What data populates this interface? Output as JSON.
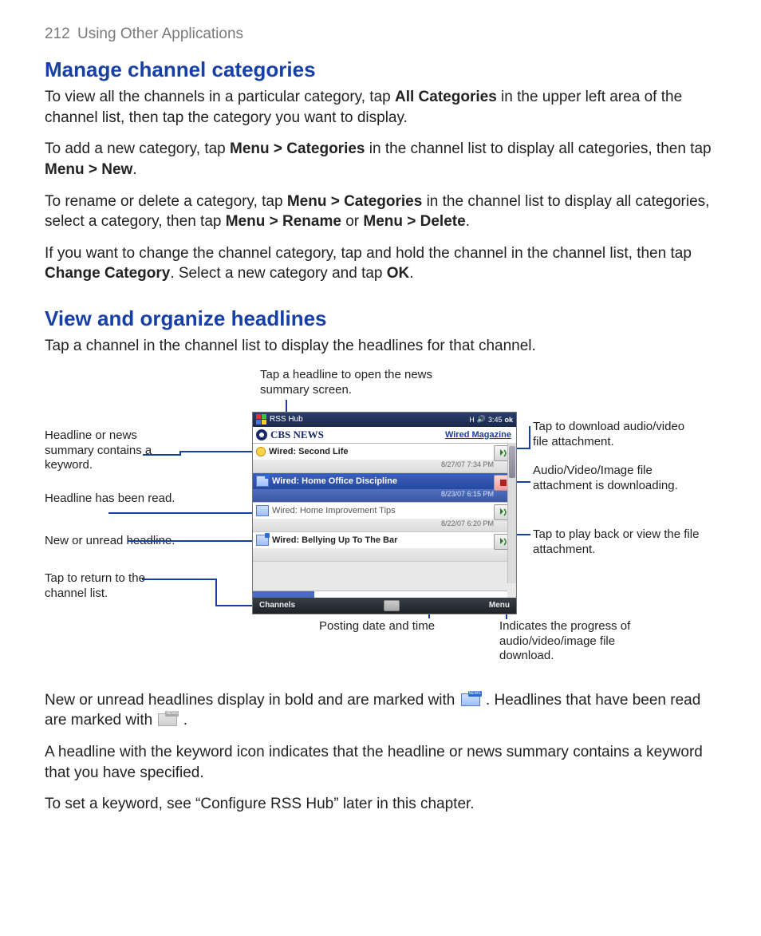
{
  "page": {
    "number": "212",
    "running_head": "Using Other Applications"
  },
  "section1": {
    "title": "Manage channel categories",
    "p1_a": "To view all the channels in a particular category, tap ",
    "p1_b": "All Categories",
    "p1_c": " in the upper left area of the channel list, then tap the category you want to display.",
    "p2_a": "To add a new category, tap ",
    "p2_b": "Menu > Categories",
    "p2_c": " in the channel list to display all categories, then tap ",
    "p2_d": "Menu > New",
    "p2_e": ".",
    "p3_a": "To rename or delete a category, tap ",
    "p3_b": "Menu > Categories",
    "p3_c": " in the channel list to display all categories, select a category, then tap ",
    "p3_d": "Menu > Rename",
    "p3_e": " or ",
    "p3_f": "Menu > Delete",
    "p3_g": ".",
    "p4_a": "If you want to change the channel category, tap and hold the channel in the channel list, then tap ",
    "p4_b": "Change Category",
    "p4_c": ". Select a new category and tap ",
    "p4_d": "OK",
    "p4_e": "."
  },
  "section2": {
    "title": "View and organize headlines",
    "intro": "Tap a channel in the channel list to display the headlines for that channel.",
    "after_fig": {
      "p1_a": "New or unread headlines display in bold and are marked with",
      "p1_b": ". Headlines that have been read are marked with",
      "p1_c": ".",
      "p2": "A headline with the keyword icon indicates that the headline or news summary contains a keyword that you have specified.",
      "p3": "To set a keyword, see “Configure RSS Hub” later in this chapter."
    }
  },
  "callouts": {
    "top": "Tap a headline to open the news summary screen.",
    "left1": "Headline or news summary contains a keyword.",
    "left2": "Headline has been read.",
    "left3": "New or unread headline.",
    "left4": "Tap to return to the channel list.",
    "right1": "Tap to download audio/video file attachment.",
    "right2": "Audio/Video/Image file attachment is downloading.",
    "right3": "Tap to play back or view the file attachment.",
    "bottom_center": "Posting date and time",
    "bottom_right": "Indicates the progress of audio/video/image file download."
  },
  "device": {
    "status": {
      "app": "RSS Hub",
      "sig": "H",
      "time": "3:45",
      "ok": "ok",
      "speaker": "🔊"
    },
    "channel": {
      "brand": "CBS NEWS",
      "magazine": "Wired Magazine"
    },
    "rows": [
      {
        "title": "Wired: Second Life",
        "date": "8/27/07 7:34 PM",
        "keyword": true,
        "unread": true,
        "attach": "play"
      },
      {
        "title": "Wired: Home Office Discipline",
        "date": "8/23/07 6:15 PM",
        "selected": true,
        "attach": "downloading"
      },
      {
        "title": "Wired: Home Improvement Tips",
        "date": "8/22/07 6:20 PM",
        "read": true,
        "attach": "play"
      },
      {
        "title": "Wired: Bellying Up To The Bar",
        "date": "",
        "unread": true,
        "attach": "play"
      }
    ],
    "softkeys": {
      "left": "Channels",
      "right": "Menu"
    }
  }
}
